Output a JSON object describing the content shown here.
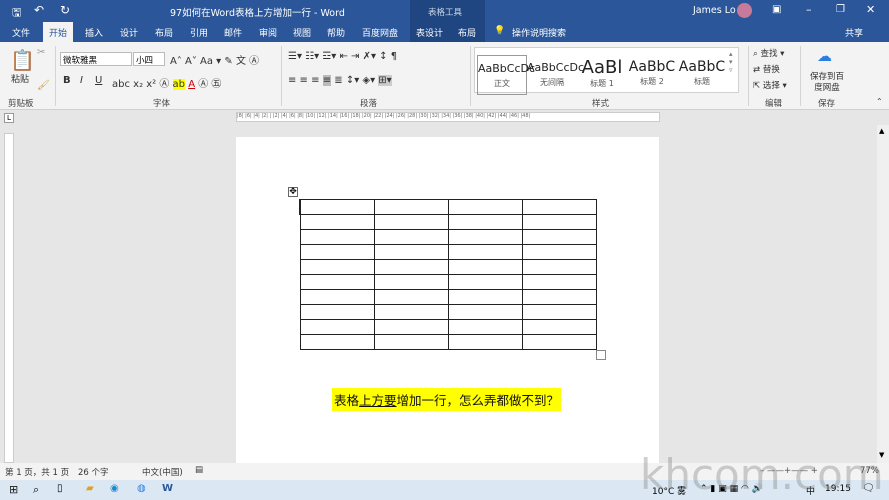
{
  "titlebar": {
    "document_title": "97如何在Word表格上方增加一行 - Word",
    "context_tools": "表格工具",
    "user": "James Lo"
  },
  "tabs": [
    "文件",
    "开始",
    "插入",
    "设计",
    "布局",
    "引用",
    "邮件",
    "审阅",
    "视图",
    "帮助",
    "百度网盘",
    "表设计",
    "布局"
  ],
  "tell_me": "操作说明搜索",
  "share": "共享",
  "ribbon": {
    "clipboard": {
      "paste": "粘贴",
      "label": "剪贴板"
    },
    "font": {
      "name": "微软雅黑",
      "size": "小四",
      "label": "字体",
      "bold": "B",
      "italic": "I",
      "underline": "U"
    },
    "paragraph": {
      "label": "段落"
    },
    "styles": {
      "label": "样式",
      "items": [
        {
          "sample": "AaBbCcDc",
          "name": "正文"
        },
        {
          "sample": "AaBbCcDc",
          "name": "无间隔"
        },
        {
          "sample": "AaBl",
          "name": "标题 1"
        },
        {
          "sample": "AaBbC",
          "name": "标题 2"
        },
        {
          "sample": "AaBbC",
          "name": "标题"
        }
      ]
    },
    "editing": {
      "find": "查找",
      "replace": "替换",
      "select": "选择",
      "label": "编辑"
    },
    "save": {
      "button": "保存到百度网盘",
      "label": "保存"
    }
  },
  "ruler": "|8| |6| |4| |2|  | |2| |4| |6| |8| |10| |12| |14| |16| |18| |20| |22| |24| |26| |28| |30| |32| |34| |36| |38| |40| |42| |44| |46| |48|",
  "document": {
    "table": {
      "rows": 10,
      "cols": 4
    },
    "caption_pre": "表格",
    "caption_underlined": "上方要",
    "caption_post": "增加一行，怎么弄都做不到？",
    "highlight": "#ffff00"
  },
  "status": {
    "page": "第 1 页，共 1 页",
    "words": "26 个字",
    "language": "中文(中国)",
    "zoom": "77%"
  },
  "taskbar": {
    "weather": "10°C 雾",
    "ime": "中",
    "time": "19:15"
  },
  "watermark": "khcom.com",
  "colors": {
    "word_blue": "#2b579a"
  }
}
